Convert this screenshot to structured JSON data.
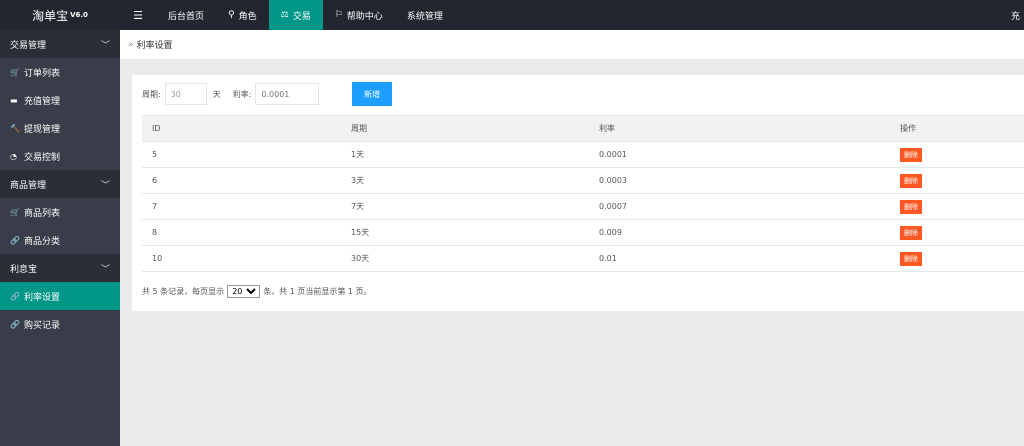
{
  "app": {
    "title": "淘单宝",
    "version": "V6.0"
  },
  "nav": {
    "menu_icon": "menu-icon",
    "items": [
      {
        "label": "后台首页",
        "icon": ""
      },
      {
        "label": "角色",
        "icon": "user-icon"
      },
      {
        "label": "交易",
        "icon": "scale-icon"
      },
      {
        "label": "帮助中心",
        "icon": "flag-icon"
      },
      {
        "label": "系统管理",
        "icon": ""
      }
    ],
    "active": 2,
    "right_text": "充"
  },
  "sidebar": {
    "groups": [
      {
        "label": "交易管理",
        "items": [
          {
            "label": "订单列表",
            "icon": "cart-icon"
          },
          {
            "label": "充值管理",
            "icon": "card-icon"
          },
          {
            "label": "提现管理",
            "icon": "hammer-icon"
          },
          {
            "label": "交易控制",
            "icon": "gauge-icon"
          }
        ]
      },
      {
        "label": "商品管理",
        "items": [
          {
            "label": "商品列表",
            "icon": "cart-icon"
          },
          {
            "label": "商品分类",
            "icon": "link-icon"
          }
        ]
      },
      {
        "label": "利息宝",
        "items": [
          {
            "label": "利率设置",
            "icon": "link-icon"
          },
          {
            "label": "购买记录",
            "icon": "link-icon"
          }
        ]
      }
    ],
    "active_item": "利率设置"
  },
  "breadcrumb": {
    "label": "利率设置"
  },
  "form": {
    "cycle_label": "周期:",
    "cycle_value": "30",
    "day_unit": "天",
    "rate_label": "利率:",
    "rate_placeholder": "0.0001",
    "add_button": "新增"
  },
  "table": {
    "headers": [
      "ID",
      "周期",
      "利率",
      "操作"
    ],
    "rows": [
      {
        "id": "5",
        "cycle": "1天",
        "rate": "0.0001",
        "action": "删除"
      },
      {
        "id": "6",
        "cycle": "3天",
        "rate": "0.0003",
        "action": "删除"
      },
      {
        "id": "7",
        "cycle": "7天",
        "rate": "0.0007",
        "action": "删除"
      },
      {
        "id": "8",
        "cycle": "15天",
        "rate": "0.009",
        "action": "删除"
      },
      {
        "id": "10",
        "cycle": "30天",
        "rate": "0.01",
        "action": "删除"
      }
    ]
  },
  "pager": {
    "prefix": "共 5 条记录，每页显示",
    "page_size": "20",
    "suffix": "条，共 1 页当前显示第 1 页。"
  },
  "colors": {
    "accent": "#009688",
    "topbar": "#23262e",
    "sidebar": "#393d49",
    "primary_button": "#1e9fff",
    "danger_button": "#ff5722"
  }
}
